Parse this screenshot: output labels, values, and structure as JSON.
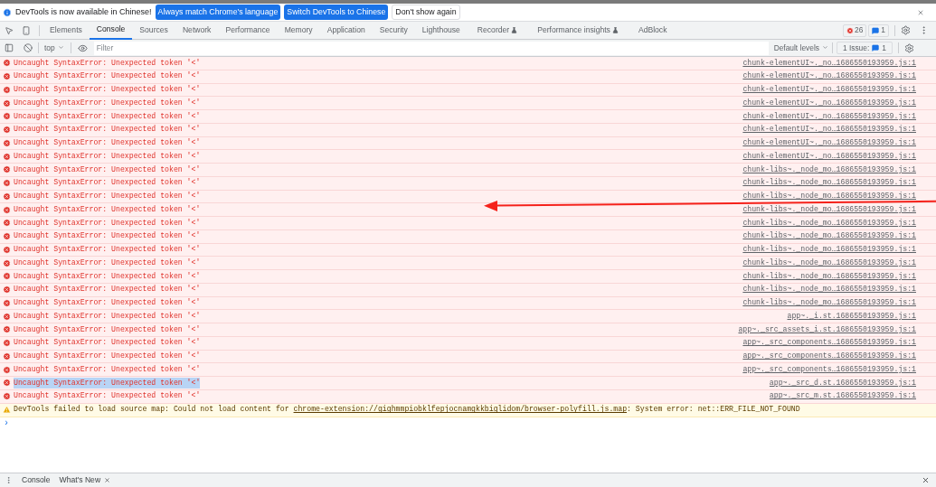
{
  "infobar": {
    "message": "DevTools is now available in Chinese!",
    "buttons": [
      {
        "label": "Always match Chrome's language",
        "kind": "primary"
      },
      {
        "label": "Switch DevTools to Chinese",
        "kind": "primary"
      },
      {
        "label": "Don't show again",
        "kind": "secondary"
      }
    ]
  },
  "tabs": [
    {
      "label": "Elements",
      "selected": false,
      "experimental": false
    },
    {
      "label": "Console",
      "selected": true,
      "experimental": false
    },
    {
      "label": "Sources",
      "selected": false,
      "experimental": false
    },
    {
      "label": "Network",
      "selected": false,
      "experimental": false
    },
    {
      "label": "Performance",
      "selected": false,
      "experimental": false
    },
    {
      "label": "Memory",
      "selected": false,
      "experimental": false
    },
    {
      "label": "Application",
      "selected": false,
      "experimental": false
    },
    {
      "label": "Security",
      "selected": false,
      "experimental": false
    },
    {
      "label": "Lighthouse",
      "selected": false,
      "experimental": false
    },
    {
      "label": "Recorder",
      "selected": false,
      "experimental": true
    },
    {
      "label": "Performance insights",
      "selected": false,
      "experimental": true
    },
    {
      "label": "AdBlock",
      "selected": false,
      "experimental": false
    }
  ],
  "counters": {
    "errors": "26",
    "messages": "1"
  },
  "toolbar": {
    "context": "top",
    "filter_placeholder": "Filter",
    "levels": "Default levels",
    "issues_label": "1 Issue:",
    "issues_count": "1"
  },
  "messages": [
    {
      "kind": "error",
      "text": "Uncaught SyntaxError: Unexpected token '<'",
      "source": "chunk-elementUI~._no…1686550193959.js:1",
      "selected": false
    },
    {
      "kind": "error",
      "text": "Uncaught SyntaxError: Unexpected token '<'",
      "source": "chunk-elementUI~._no…1686550193959.js:1",
      "selected": false
    },
    {
      "kind": "error",
      "text": "Uncaught SyntaxError: Unexpected token '<'",
      "source": "chunk-elementUI~._no…1686550193959.js:1",
      "selected": false
    },
    {
      "kind": "error",
      "text": "Uncaught SyntaxError: Unexpected token '<'",
      "source": "chunk-elementUI~._no…1686550193959.js:1",
      "selected": false
    },
    {
      "kind": "error",
      "text": "Uncaught SyntaxError: Unexpected token '<'",
      "source": "chunk-elementUI~._no…1686550193959.js:1",
      "selected": false
    },
    {
      "kind": "error",
      "text": "Uncaught SyntaxError: Unexpected token '<'",
      "source": "chunk-elementUI~._no…1686550193959.js:1",
      "selected": false
    },
    {
      "kind": "error",
      "text": "Uncaught SyntaxError: Unexpected token '<'",
      "source": "chunk-elementUI~._no…1686550193959.js:1",
      "selected": false
    },
    {
      "kind": "error",
      "text": "Uncaught SyntaxError: Unexpected token '<'",
      "source": "chunk-elementUI~._no…1686550193959.js:1",
      "selected": false
    },
    {
      "kind": "error",
      "text": "Uncaught SyntaxError: Unexpected token '<'",
      "source": "chunk-libs~._node_mo…1686550193959.js:1",
      "selected": false
    },
    {
      "kind": "error",
      "text": "Uncaught SyntaxError: Unexpected token '<'",
      "source": "chunk-libs~._node_mo…1686550193959.js:1",
      "selected": false
    },
    {
      "kind": "error",
      "text": "Uncaught SyntaxError: Unexpected token '<'",
      "source": "chunk-libs~._node_mo…1686550193959.js:1",
      "selected": false
    },
    {
      "kind": "error",
      "text": "Uncaught SyntaxError: Unexpected token '<'",
      "source": "chunk-libs~._node_mo…1686550193959.js:1",
      "selected": false
    },
    {
      "kind": "error",
      "text": "Uncaught SyntaxError: Unexpected token '<'",
      "source": "chunk-libs~._node_mo…1686550193959.js:1",
      "selected": false
    },
    {
      "kind": "error",
      "text": "Uncaught SyntaxError: Unexpected token '<'",
      "source": "chunk-libs~._node_mo…1686550193959.js:1",
      "selected": false
    },
    {
      "kind": "error",
      "text": "Uncaught SyntaxError: Unexpected token '<'",
      "source": "chunk-libs~._node_mo…1686550193959.js:1",
      "selected": false
    },
    {
      "kind": "error",
      "text": "Uncaught SyntaxError: Unexpected token '<'",
      "source": "chunk-libs~._node_mo…1686550193959.js:1",
      "selected": false
    },
    {
      "kind": "error",
      "text": "Uncaught SyntaxError: Unexpected token '<'",
      "source": "chunk-libs~._node_mo…1686550193959.js:1",
      "selected": false
    },
    {
      "kind": "error",
      "text": "Uncaught SyntaxError: Unexpected token '<'",
      "source": "chunk-libs~._node_mo…1686550193959.js:1",
      "selected": false
    },
    {
      "kind": "error",
      "text": "Uncaught SyntaxError: Unexpected token '<'",
      "source": "chunk-libs~._node_mo…1686550193959.js:1",
      "selected": false
    },
    {
      "kind": "error",
      "text": "Uncaught SyntaxError: Unexpected token '<'",
      "source": "app~._i.st.1686550193959.js:1",
      "selected": false
    },
    {
      "kind": "error",
      "text": "Uncaught SyntaxError: Unexpected token '<'",
      "source": "app~._src_assets_i.st.1686550193959.js:1",
      "selected": false
    },
    {
      "kind": "error",
      "text": "Uncaught SyntaxError: Unexpected token '<'",
      "source": "app~._src_components…1686550193959.js:1",
      "selected": false
    },
    {
      "kind": "error",
      "text": "Uncaught SyntaxError: Unexpected token '<'",
      "source": "app~._src_components…1686550193959.js:1",
      "selected": false
    },
    {
      "kind": "error",
      "text": "Uncaught SyntaxError: Unexpected token '<'",
      "source": "app~._src_components…1686550193959.js:1",
      "selected": false
    },
    {
      "kind": "error",
      "text": "Uncaught SyntaxError: Unexpected token '<'",
      "source": "app~._src_d.st.1686550193959.js:1",
      "selected": true
    },
    {
      "kind": "error",
      "text": "Uncaught SyntaxError: Unexpected token '<'",
      "source": "app~._src_m.st.1686550193959.js:1",
      "selected": false
    },
    {
      "kind": "warning",
      "text": "DevTools failed to load source map: Could not load content for",
      "link": "chrome-extension://gighmmpiobklfepjocnamgkkbiglidom/browser-polyfill.js.map",
      "suffix": ": System error: net::ERR_FILE_NOT_FOUND",
      "selected": false
    }
  ],
  "prompt": "›",
  "drawer_tabs": [
    {
      "label": "Console",
      "closable": false
    },
    {
      "label": "What's New",
      "closable": true
    }
  ]
}
